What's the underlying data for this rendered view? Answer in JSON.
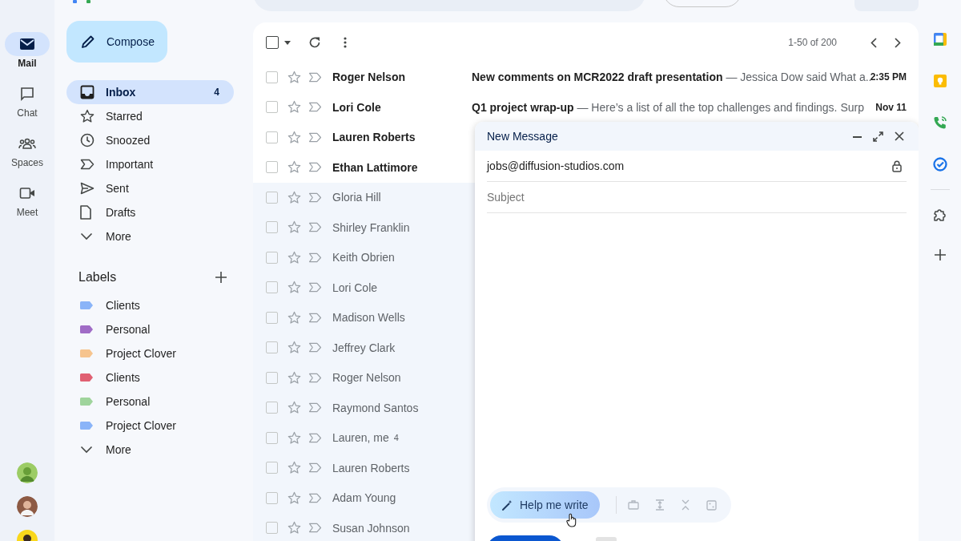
{
  "rail": [
    {
      "label": "Mail",
      "selected": true
    },
    {
      "label": "Chat",
      "selected": false
    },
    {
      "label": "Spaces",
      "selected": false
    },
    {
      "label": "Meet",
      "selected": false
    }
  ],
  "compose_button": "Compose",
  "folders": [
    {
      "label": "Inbox",
      "count": "4",
      "selected": true
    },
    {
      "label": "Starred",
      "selected": false
    },
    {
      "label": "Snoozed",
      "selected": false
    },
    {
      "label": "Important",
      "selected": false
    },
    {
      "label": "Sent",
      "selected": false
    },
    {
      "label": "Drafts",
      "selected": false
    },
    {
      "label": "More",
      "selected": false
    }
  ],
  "labels": {
    "title": "Labels",
    "items": [
      {
        "name": "Clients",
        "color": "#8ab4f8"
      },
      {
        "name": "Personal",
        "color": "#a06cc6"
      },
      {
        "name": "Project Clover",
        "color": "#f6c48e"
      },
      {
        "name": "Clients",
        "color": "#e06072"
      },
      {
        "name": "Personal",
        "color": "#9fd49c"
      },
      {
        "name": "Project Clover",
        "color": "#8ab4f8"
      }
    ],
    "more": "More"
  },
  "toolbar": {
    "select_all_checked": false,
    "range": "1-50 of 200"
  },
  "emails": [
    {
      "sender": "Roger Nelson",
      "unread": true,
      "subject": "New comments on MCR2022 draft presentation",
      "snippet": " — Jessica Dow said What a...",
      "time": "2:35 PM"
    },
    {
      "sender": "Lori Cole",
      "unread": true,
      "subject": "Q1 project wrap-up",
      "snippet": " — Here’s a list of all the top challenges and findings. Surp",
      "time": "Nov 11"
    },
    {
      "sender": "Lauren Roberts",
      "unread": true
    },
    {
      "sender": "Ethan Lattimore",
      "unread": true
    },
    {
      "sender": "Gloria Hill",
      "unread": false
    },
    {
      "sender": "Shirley Franklin",
      "unread": false
    },
    {
      "sender": "Keith Obrien",
      "unread": false
    },
    {
      "sender": "Lori Cole",
      "unread": false
    },
    {
      "sender": "Madison Wells",
      "unread": false
    },
    {
      "sender": "Jeffrey Clark",
      "unread": false
    },
    {
      "sender": "Roger Nelson",
      "unread": false
    },
    {
      "sender": "Raymond Santos",
      "unread": false
    },
    {
      "sender": "Lauren, me",
      "count": "4",
      "unread": false
    },
    {
      "sender": "Lauren Roberts",
      "unread": false
    },
    {
      "sender": "Adam Young",
      "unread": false
    },
    {
      "sender": "Susan Johnson",
      "unread": false
    }
  ],
  "compose": {
    "title": "New Message",
    "to": "jobs@diffusion-studios.com",
    "subject_placeholder": "Subject",
    "help_me_write": "Help me write"
  }
}
